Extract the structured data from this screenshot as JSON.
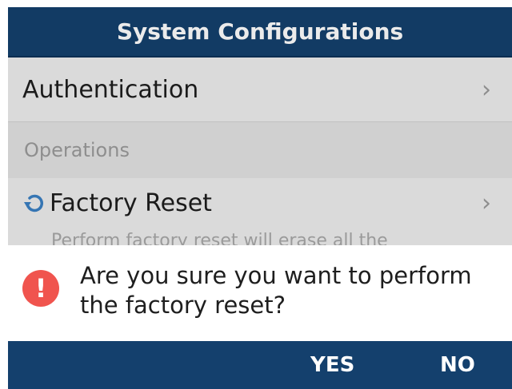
{
  "header": {
    "title": "System Configurations"
  },
  "list": {
    "authentication": {
      "label": "Authentication"
    },
    "section": {
      "label": "Operations"
    },
    "factory_reset": {
      "label": "Factory Reset",
      "description": "Perform factory reset will erase all the"
    }
  },
  "dialog": {
    "message_line1": "Are you sure you want to perform",
    "message_line2": "the factory reset?",
    "yes_label": "YES",
    "no_label": "NO"
  },
  "icons": {
    "chevron": "chevron-right-icon",
    "reset": "refresh-icon",
    "warning": "exclamation-icon"
  },
  "colors": {
    "header_bg": "#14406d",
    "warning": "#f0544e",
    "reset_icon": "#3a7fc3"
  }
}
